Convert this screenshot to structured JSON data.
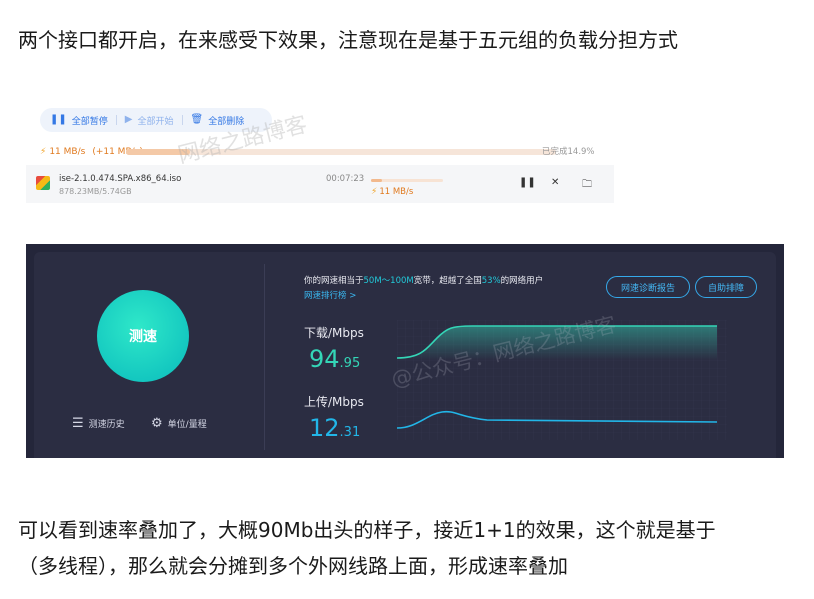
{
  "article": {
    "intro": "两个接口都开启，在来感受下效果，注意现在是基于五元组的负载分担方式",
    "conclusion_line1": "可以看到速率叠加了，大概90Mb出头的样子，接近1+1的效果，这个就是基于",
    "conclusion_line2": "（多线程），那么就会分摊到多个外网线路上面，形成速率叠加"
  },
  "download": {
    "toolbar": {
      "pause_all": "全部暂停",
      "start_all": "全部开始",
      "delete_all": "全部删除"
    },
    "total_speed": "11 MB/s",
    "total_speed_extra": "(+11 MB/s)",
    "total_progress_text": "已完成14.9%",
    "total_progress": 0.149,
    "file": {
      "name": "ise-2.1.0.474.SPA.x86_64.iso",
      "size": "878.23MB/5.74GB",
      "time": "00:07:23",
      "speed": "11 MB/s",
      "progress": 0.149
    },
    "watermark": "网络之路博客"
  },
  "speedtest": {
    "start_button": "测速",
    "history_link": "测速历史",
    "unit_link": "单位/量程",
    "summary_prefix": "你的网速相当于",
    "summary_range": "50M～100M",
    "summary_mid": "宽带，超越了全国",
    "summary_percent": "53%",
    "summary_suffix": "的网络用户",
    "rank_link": "网速排行榜 >",
    "diag_button": "网速诊断报告",
    "troubleshoot_button": "自助排障",
    "download_label": "下载/Mbps",
    "download_int": "94",
    "download_dec": ".95",
    "upload_label": "上传/Mbps",
    "upload_int": "12",
    "upload_dec": ".31",
    "watermark": "@公众号：网络之路博客",
    "colors": {
      "download": "#34d6b7",
      "upload": "#22b6e8",
      "accent_link": "#3ab7f0"
    }
  }
}
